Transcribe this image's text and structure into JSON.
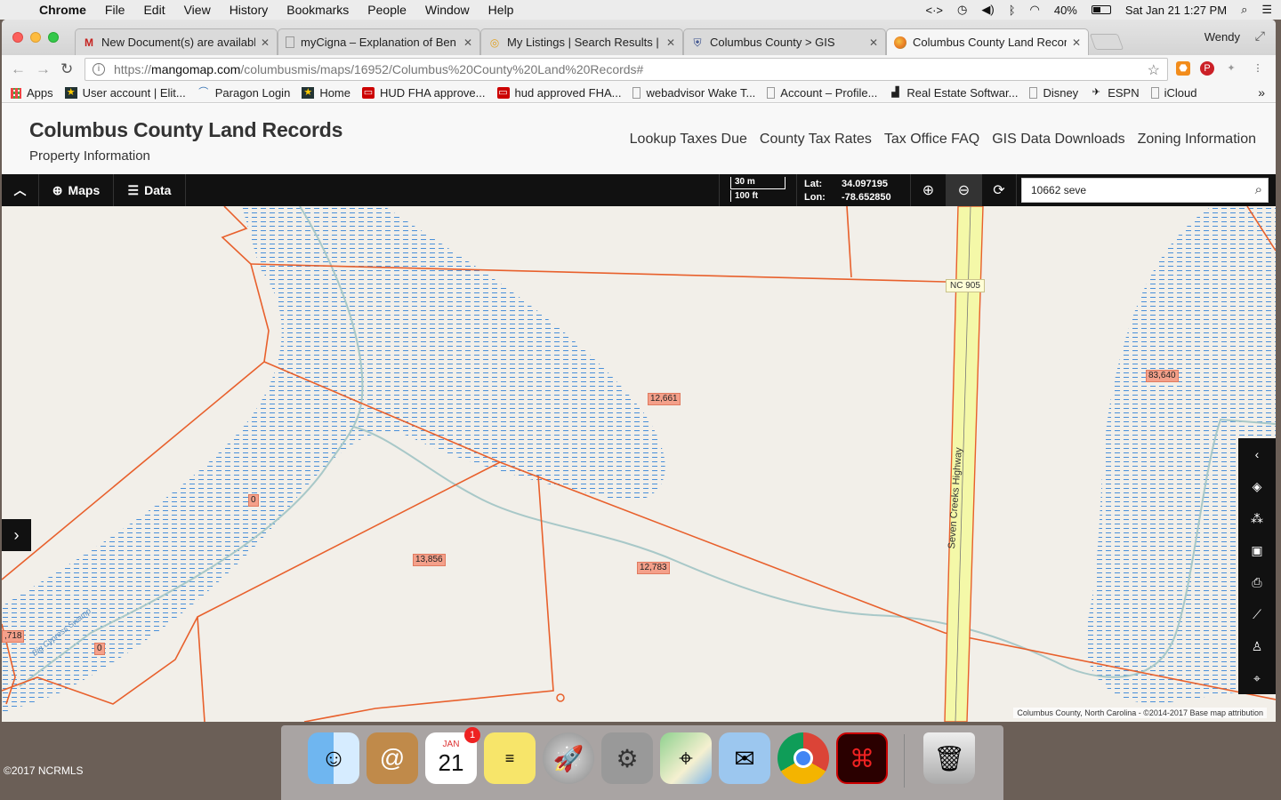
{
  "menubar": {
    "app": "Chrome",
    "items": [
      "File",
      "Edit",
      "View",
      "History",
      "Bookmarks",
      "People",
      "Window",
      "Help"
    ],
    "battery": "40%",
    "datetime": "Sat Jan 21  1:27 PM"
  },
  "tabs": [
    {
      "label": "New Document(s) are availabl",
      "icon": "gmail-icon",
      "color": "#c5221f"
    },
    {
      "label": "myCigna – Explanation of Ben",
      "icon": "document-icon",
      "color": "#777"
    },
    {
      "label": "My Listings | Search Results |",
      "icon": "listing-icon",
      "color": "#e0a020"
    },
    {
      "label": "Columbus County > GIS",
      "icon": "shield-icon",
      "color": "#334a8a"
    },
    {
      "label": "Columbus County Land Recor",
      "icon": "mango-icon",
      "color": "#e87722"
    }
  ],
  "profile": "Wendy",
  "omnibox": {
    "url_prefix": "https://",
    "url_host": "mangomap.com",
    "url_path": "/columbusmis/maps/16952/Columbus%20County%20Land%20Records#"
  },
  "bookmarks": [
    {
      "label": "Apps",
      "icon": "apps-grid-icon"
    },
    {
      "label": "User account | Elit...",
      "icon": "elite-icon"
    },
    {
      "label": "Paragon Login",
      "icon": "paragon-icon"
    },
    {
      "label": "Home",
      "icon": "home-icon"
    },
    {
      "label": "HUD FHA approve...",
      "icon": "hud-icon"
    },
    {
      "label": "hud approved FHA...",
      "icon": "hud-icon"
    },
    {
      "label": "webadvisor Wake T...",
      "icon": "page-icon"
    },
    {
      "label": "Account – Profile...",
      "icon": "page-icon"
    },
    {
      "label": "Real Estate Softwar...",
      "icon": "chart-icon"
    },
    {
      "label": "Disney",
      "icon": "page-icon"
    },
    {
      "label": "ESPN",
      "icon": "espn-icon"
    },
    {
      "label": "iCloud",
      "icon": "page-icon"
    }
  ],
  "site": {
    "title": "Columbus County Land Records",
    "subtitle": "Property Information",
    "nav": [
      "Lookup Taxes Due",
      "County Tax Rates",
      "Tax Office FAQ",
      "GIS Data Downloads",
      "Zoning Information"
    ]
  },
  "maptoolbar": {
    "maps_label": "Maps",
    "data_label": "Data",
    "scale_metric": "30 m",
    "scale_imperial": "100 ft",
    "lat_label": "Lat:",
    "lat_value": "34.097195",
    "lon_label": "Lon:",
    "lon_value": "-78.652850",
    "search_value": "10662 seve"
  },
  "map": {
    "parcels": [
      "12,661",
      "0",
      "13,856",
      "12,783",
      "0",
      "83,640",
      ",718"
    ],
    "road_shield": "NC 905",
    "road_name": "Seven Creeks Highway",
    "water_name": "Big Cypress Swamp",
    "attribution": "Columbus County, North Carolina - ©2014-2017    Base map attribution"
  },
  "colors": {
    "parcel_line": "#e8602c",
    "water": "#4a90d9",
    "road_fill": "#f4f8a8",
    "toolbar": "#111111"
  },
  "desktop": {
    "credit": "©2017 NCRMLS",
    "dock_apps": [
      "finder-icon",
      "contacts-icon",
      "calendar-icon",
      "stickies-icon",
      "launchpad-icon",
      "system-preferences-icon",
      "maps-icon",
      "mail-icon",
      "chrome-icon",
      "acrobat-icon",
      "trash-icon"
    ],
    "calendar_day": "21",
    "calendar_month": "JAN",
    "calendar_badge": "1"
  }
}
